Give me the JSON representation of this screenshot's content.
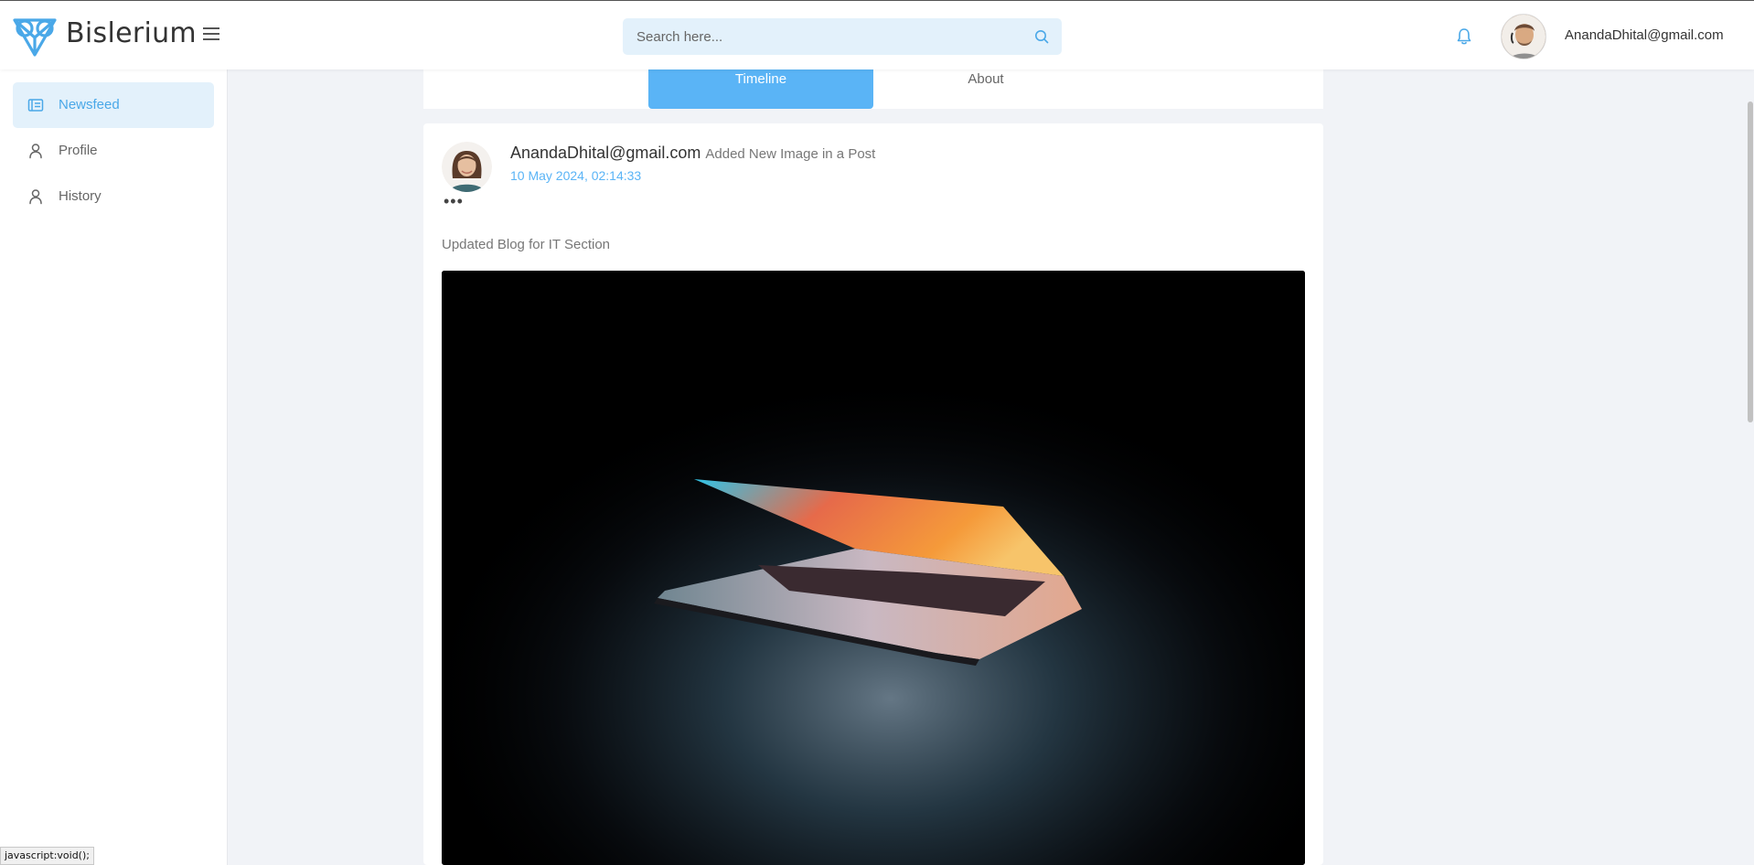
{
  "app": {
    "brand": "Bislerium",
    "brand_color": "#4aa8e8"
  },
  "search": {
    "placeholder": "Search here...",
    "value": ""
  },
  "header": {
    "user_email": "AnandaDhital@gmail.com",
    "icons": [
      "bell-icon",
      "search-icon",
      "menu-icon"
    ]
  },
  "sidebar": {
    "items": [
      {
        "label": "Newsfeed",
        "icon": "newsfeed-icon",
        "active": true
      },
      {
        "label": "Profile",
        "icon": "user-icon",
        "active": false
      },
      {
        "label": "History",
        "icon": "user-icon",
        "active": false
      }
    ]
  },
  "tabs": [
    {
      "label": "Timeline",
      "active": true
    },
    {
      "label": "About",
      "active": false
    }
  ],
  "post": {
    "author": "AnandaDhital@gmail.com",
    "action": "Added New Image in a Post",
    "timestamp": "10 May 2024, 02:14:33",
    "more": "•••",
    "text": "Updated Blog for IT Section"
  },
  "status_bar": {
    "text": "javascript:void();"
  }
}
